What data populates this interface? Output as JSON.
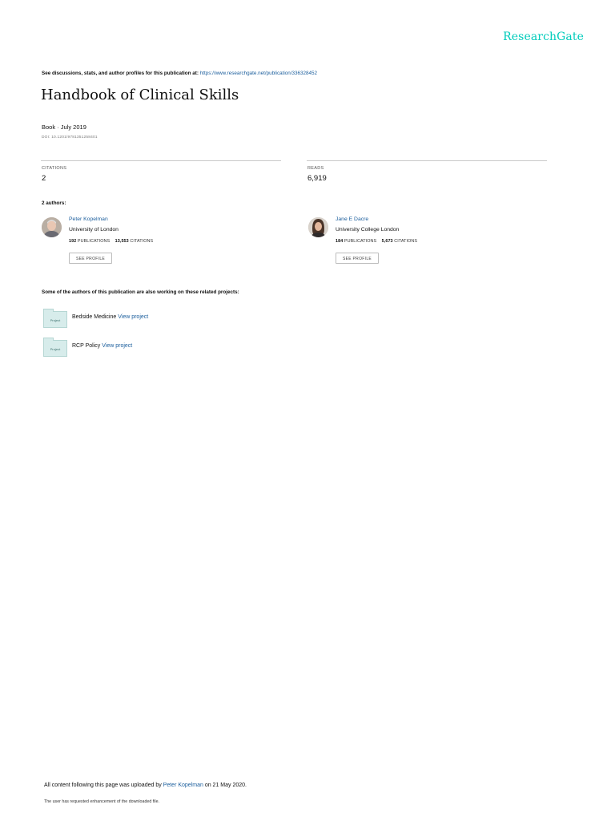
{
  "brand": "ResearchGate",
  "header": {
    "see_prefix": "See discussions, stats, and author profiles for this publication at:",
    "url": "https://www.researchgate.net/publication/336328452"
  },
  "publication": {
    "title": "Handbook of Clinical Skills",
    "meta": "Book · July 2019",
    "doi": "DOI: 10.1201/9781351258401"
  },
  "stats": {
    "citations_label": "CITATIONS",
    "citations_value": "2",
    "reads_label": "READS",
    "reads_value": "6,919"
  },
  "authors_heading": "2 authors:",
  "authors": [
    {
      "name": "Peter Kopelman",
      "institution": "University of London",
      "publications": "192",
      "publications_label": "PUBLICATIONS",
      "citations": "13,553",
      "citations_label": "CITATIONS",
      "button": "SEE PROFILE"
    },
    {
      "name": "Jane E Dacre",
      "institution": "University College London",
      "publications": "184",
      "publications_label": "PUBLICATIONS",
      "citations": "5,673",
      "citations_label": "CITATIONS",
      "button": "SEE PROFILE"
    }
  ],
  "projects_heading": "Some of the authors of this publication are also working on these related projects:",
  "projects": [
    {
      "icon_label": "Project",
      "name": "Bedside Medicine",
      "link": "View project"
    },
    {
      "icon_label": "Project",
      "name": "RCP Policy",
      "link": "View project"
    }
  ],
  "footer": {
    "prefix": "All content following this page was uploaded by",
    "uploader": "Peter Kopelman",
    "suffix": "on 21 May 2020.",
    "note": "The user has requested enhancement of the downloaded file."
  },
  "colors": {
    "brand": "#00ccbb",
    "link": "#1a5d9c",
    "project_icon": "#d7eceb"
  }
}
